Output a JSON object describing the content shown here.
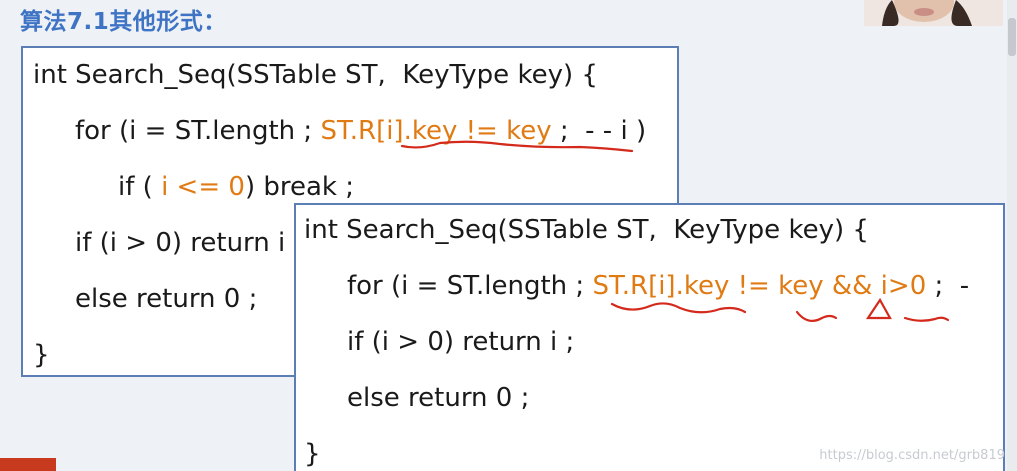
{
  "slide": {
    "title": "算法7.1其他形式：",
    "title_color": "#3f73c4",
    "code_color": "#1a1a1a",
    "highlight_color": "#e07b14",
    "annotation_color": "#d42a1c"
  },
  "code_box_1": {
    "line1": "int Search_Seq(SSTable ST,  KeyType key) {",
    "line2_pre": "for (i = ST.length ; ",
    "line2_hl": "ST.R[i].key != key",
    "line2_post": " ;  - - i )",
    "line3_pre": "if ( ",
    "line3_hl": "i <= 0",
    "line3_post": ") break ;",
    "line4": "if (i > 0) return i ;",
    "line5": "else return 0 ;",
    "line6": "}"
  },
  "code_box_2": {
    "line1": "int Search_Seq(SSTable ST,  KeyType key) {",
    "line2_pre": "for (i = ST.length ; ",
    "line2_hl": "ST.R[i].key != key && i>0",
    "line2_post": " ;  -",
    "line3": "if (i > 0) return i ;",
    "line4": "else return 0 ;",
    "line5": "}"
  },
  "watermark": "https://blog.csdn.net/grb819"
}
